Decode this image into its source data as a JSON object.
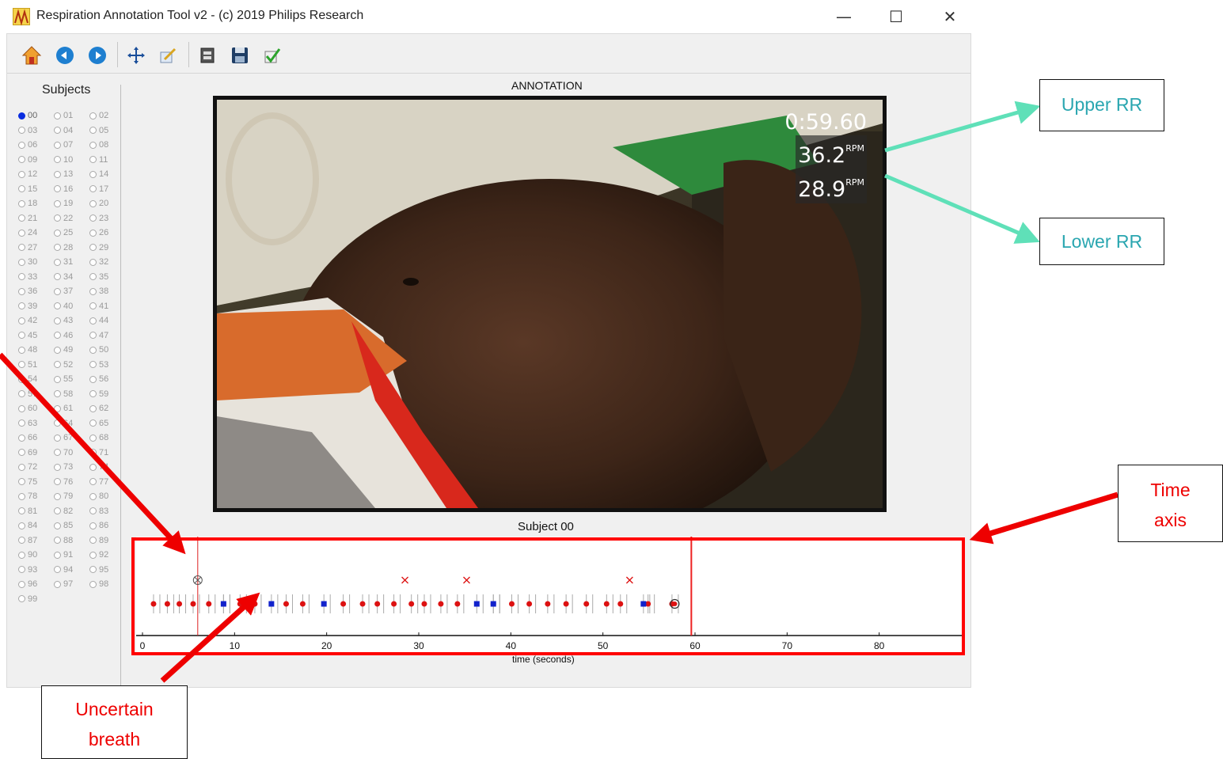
{
  "window": {
    "title": "Respiration Annotation Tool v2 - (c) 2019 Philips Research",
    "controls": {
      "minimize": "—",
      "maximize": "☐",
      "close": "✕"
    }
  },
  "toolbar": {
    "buttons": [
      {
        "name": "home-button",
        "icon": "home-icon"
      },
      {
        "name": "back-button",
        "icon": "arrow-left-icon"
      },
      {
        "name": "forward-button",
        "icon": "arrow-right-icon"
      },
      {
        "name": "pan-button",
        "icon": "move-icon"
      },
      {
        "name": "edit-button",
        "icon": "edit-icon"
      },
      {
        "name": "configure-button",
        "icon": "settings-icon"
      },
      {
        "name": "save-button",
        "icon": "floppy-icon"
      },
      {
        "name": "check-button",
        "icon": "checkmark-icon"
      }
    ]
  },
  "subjects": {
    "title": "Subjects",
    "selected": "00",
    "items": [
      "00",
      "01",
      "02",
      "03",
      "04",
      "05",
      "06",
      "07",
      "08",
      "09",
      "10",
      "11",
      "12",
      "13",
      "14",
      "15",
      "16",
      "17",
      "18",
      "19",
      "20",
      "21",
      "22",
      "23",
      "24",
      "25",
      "26",
      "27",
      "28",
      "29",
      "30",
      "31",
      "32",
      "33",
      "34",
      "35",
      "36",
      "37",
      "38",
      "39",
      "40",
      "41",
      "42",
      "43",
      "44",
      "45",
      "46",
      "47",
      "48",
      "49",
      "50",
      "51",
      "52",
      "53",
      "54",
      "55",
      "56",
      "57",
      "58",
      "59",
      "60",
      "61",
      "62",
      "63",
      "64",
      "65",
      "66",
      "67",
      "68",
      "69",
      "70",
      "71",
      "72",
      "73",
      "74",
      "75",
      "76",
      "77",
      "78",
      "79",
      "80",
      "81",
      "82",
      "83",
      "84",
      "85",
      "86",
      "87",
      "88",
      "89",
      "90",
      "91",
      "92",
      "93",
      "94",
      "95",
      "96",
      "97",
      "98",
      "99"
    ]
  },
  "annotation": {
    "title": "ANNOTATION",
    "overlay": {
      "time": "0:59.60",
      "upper_rr": "36.2",
      "lower_rr": "28.9",
      "unit": "RPM"
    }
  },
  "plot": {
    "subject_label": "Subject 00",
    "xlabel": "time (seconds)"
  },
  "chart_data": {
    "type": "scatter",
    "xlabel": "time (seconds)",
    "xlim": [
      0,
      90
    ],
    "xticks": [
      0,
      10,
      20,
      30,
      40,
      50,
      60,
      70,
      80
    ],
    "tick_labels": [
      "0",
      "10",
      "20",
      "30",
      "40",
      "50",
      "60",
      "70",
      "80"
    ],
    "cursor_x": 6.0,
    "current_time_x": 59.6,
    "breaths_certain": [
      1.2,
      2.7,
      4.0,
      5.5,
      7.2,
      8.8,
      10.6,
      12.2,
      15.6,
      17.4,
      21.8,
      23.9,
      25.5,
      27.3,
      29.2,
      30.6,
      32.4,
      34.2,
      38.1,
      40.1,
      42.0,
      44.0,
      46.0,
      48.2,
      50.4,
      51.9,
      54.9,
      57.5
    ],
    "breaths_uncertain": [
      8.8,
      14.0,
      19.7,
      36.3,
      38.1,
      54.4
    ],
    "breaths_rejected": [
      28.5,
      35.2,
      52.9
    ],
    "cursor_marker": [
      6.0,
      57.8
    ]
  },
  "callouts": {
    "upper_rr": "Upper RR",
    "lower_rr": "Lower RR",
    "time_axis_1": "Time",
    "time_axis_2": "axis",
    "uncertain_1": "Uncertain",
    "uncertain_2": "breath"
  },
  "colors": {
    "breath": "#dd1111",
    "uncertain": "#1122cc",
    "highlight": "#ff0000",
    "callout_teal": "#2aa6b0",
    "arrow_teal": "#5fe0b8"
  }
}
